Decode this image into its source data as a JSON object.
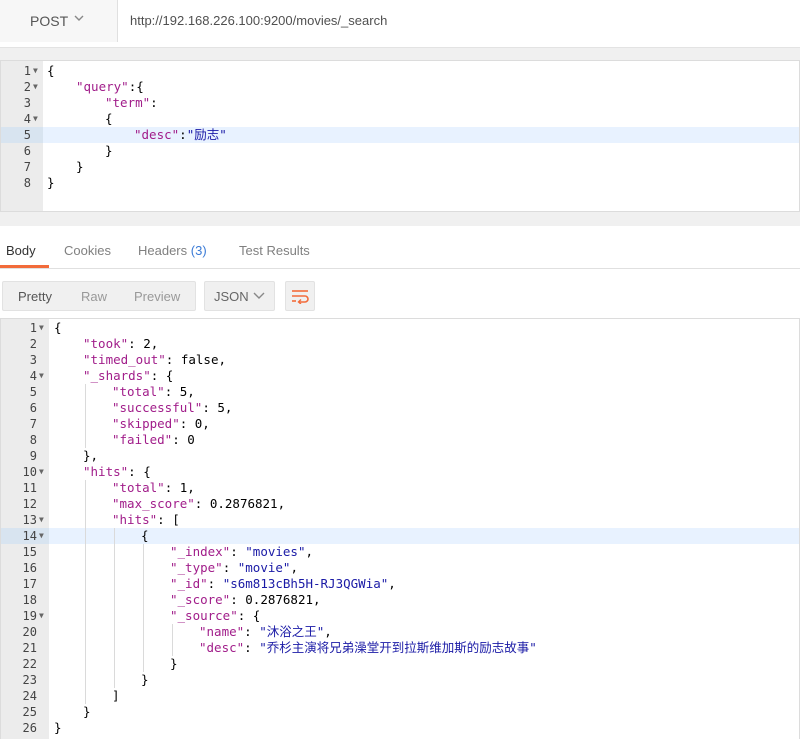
{
  "request": {
    "method": "POST",
    "url": "http://192.168.226.100:9200/movies/_search",
    "body_lines": [
      {
        "n": "1",
        "fold": true,
        "indent": 0,
        "tokens": [
          [
            "p",
            "{"
          ]
        ]
      },
      {
        "n": "2",
        "fold": true,
        "indent": 1,
        "tokens": [
          [
            "k",
            "\"query\""
          ],
          [
            "p",
            ":{"
          ]
        ]
      },
      {
        "n": "3",
        "fold": false,
        "indent": 2,
        "tokens": [
          [
            "k",
            "\"term\""
          ],
          [
            "p",
            ":"
          ]
        ]
      },
      {
        "n": "4",
        "fold": true,
        "indent": 2,
        "tokens": [
          [
            "p",
            "{"
          ]
        ]
      },
      {
        "n": "5",
        "fold": false,
        "indent": 3,
        "active": true,
        "tokens": [
          [
            "k",
            "\"desc\""
          ],
          [
            "p",
            ":"
          ],
          [
            "s",
            "\"励志\""
          ]
        ]
      },
      {
        "n": "6",
        "fold": false,
        "indent": 2,
        "tokens": [
          [
            "p",
            "}"
          ]
        ]
      },
      {
        "n": "7",
        "fold": false,
        "indent": 1,
        "tokens": [
          [
            "p",
            "}"
          ]
        ]
      },
      {
        "n": "8",
        "fold": false,
        "indent": 0,
        "tokens": [
          [
            "p",
            "}"
          ]
        ]
      }
    ]
  },
  "response_tabs": [
    {
      "label": "Body",
      "active": true
    },
    {
      "label": "Cookies"
    },
    {
      "label": "Headers",
      "badge": "(3)"
    },
    {
      "label": "Test Results"
    }
  ],
  "format_options": [
    "Pretty",
    "Raw",
    "Preview"
  ],
  "selected_format": "Pretty",
  "language": "JSON",
  "response_lines": [
    {
      "n": "1",
      "fold": true,
      "indent": 0,
      "tokens": [
        [
          "p",
          "{"
        ]
      ]
    },
    {
      "n": "2",
      "fold": false,
      "indent": 1,
      "tokens": [
        [
          "k",
          "\"took\""
        ],
        [
          "p",
          ": 2,"
        ]
      ]
    },
    {
      "n": "3",
      "fold": false,
      "indent": 1,
      "tokens": [
        [
          "k",
          "\"timed_out\""
        ],
        [
          "p",
          ": false,"
        ]
      ]
    },
    {
      "n": "4",
      "fold": true,
      "indent": 1,
      "tokens": [
        [
          "k",
          "\"_shards\""
        ],
        [
          "p",
          ": {"
        ]
      ]
    },
    {
      "n": "5",
      "fold": false,
      "indent": 2,
      "tokens": [
        [
          "k",
          "\"total\""
        ],
        [
          "p",
          ": 5,"
        ]
      ]
    },
    {
      "n": "6",
      "fold": false,
      "indent": 2,
      "tokens": [
        [
          "k",
          "\"successful\""
        ],
        [
          "p",
          ": 5,"
        ]
      ]
    },
    {
      "n": "7",
      "fold": false,
      "indent": 2,
      "tokens": [
        [
          "k",
          "\"skipped\""
        ],
        [
          "p",
          ": 0,"
        ]
      ]
    },
    {
      "n": "8",
      "fold": false,
      "indent": 2,
      "tokens": [
        [
          "k",
          "\"failed\""
        ],
        [
          "p",
          ": 0"
        ]
      ]
    },
    {
      "n": "9",
      "fold": false,
      "indent": 1,
      "tokens": [
        [
          "p",
          "},"
        ]
      ]
    },
    {
      "n": "10",
      "fold": true,
      "indent": 1,
      "tokens": [
        [
          "k",
          "\"hits\""
        ],
        [
          "p",
          ": {"
        ]
      ]
    },
    {
      "n": "11",
      "fold": false,
      "indent": 2,
      "tokens": [
        [
          "k",
          "\"total\""
        ],
        [
          "p",
          ": 1,"
        ]
      ]
    },
    {
      "n": "12",
      "fold": false,
      "indent": 2,
      "tokens": [
        [
          "k",
          "\"max_score\""
        ],
        [
          "p",
          ": 0.2876821,"
        ]
      ]
    },
    {
      "n": "13",
      "fold": true,
      "indent": 2,
      "tokens": [
        [
          "k",
          "\"hits\""
        ],
        [
          "p",
          ": ["
        ]
      ]
    },
    {
      "n": "14",
      "fold": true,
      "indent": 3,
      "active": true,
      "tokens": [
        [
          "p",
          "{"
        ]
      ]
    },
    {
      "n": "15",
      "fold": false,
      "indent": 4,
      "tokens": [
        [
          "k",
          "\"_index\""
        ],
        [
          "p",
          ": "
        ],
        [
          "s",
          "\"movies\""
        ],
        [
          "p",
          ","
        ]
      ]
    },
    {
      "n": "16",
      "fold": false,
      "indent": 4,
      "tokens": [
        [
          "k",
          "\"_type\""
        ],
        [
          "p",
          ": "
        ],
        [
          "s",
          "\"movie\""
        ],
        [
          "p",
          ","
        ]
      ]
    },
    {
      "n": "17",
      "fold": false,
      "indent": 4,
      "tokens": [
        [
          "k",
          "\"_id\""
        ],
        [
          "p",
          ": "
        ],
        [
          "s",
          "\"s6m813cBh5H-RJ3QGWia\""
        ],
        [
          "p",
          ","
        ]
      ]
    },
    {
      "n": "18",
      "fold": false,
      "indent": 4,
      "tokens": [
        [
          "k",
          "\"_score\""
        ],
        [
          "p",
          ": 0.2876821,"
        ]
      ]
    },
    {
      "n": "19",
      "fold": true,
      "indent": 4,
      "tokens": [
        [
          "k",
          "\"_source\""
        ],
        [
          "p",
          ": {"
        ]
      ]
    },
    {
      "n": "20",
      "fold": false,
      "indent": 5,
      "tokens": [
        [
          "k",
          "\"name\""
        ],
        [
          "p",
          ": "
        ],
        [
          "s",
          "\"沐浴之王\""
        ],
        [
          "p",
          ","
        ]
      ]
    },
    {
      "n": "21",
      "fold": false,
      "indent": 5,
      "tokens": [
        [
          "k",
          "\"desc\""
        ],
        [
          "p",
          ": "
        ],
        [
          "s",
          "\"乔杉主演将兄弟澡堂开到拉斯维加斯的励志故事\""
        ]
      ]
    },
    {
      "n": "22",
      "fold": false,
      "indent": 4,
      "tokens": [
        [
          "p",
          "}"
        ]
      ]
    },
    {
      "n": "23",
      "fold": false,
      "indent": 3,
      "tokens": [
        [
          "p",
          "}"
        ]
      ]
    },
    {
      "n": "24",
      "fold": false,
      "indent": 2,
      "tokens": [
        [
          "p",
          "]"
        ]
      ]
    },
    {
      "n": "25",
      "fold": false,
      "indent": 1,
      "tokens": [
        [
          "p",
          "}"
        ]
      ]
    },
    {
      "n": "26",
      "fold": false,
      "indent": 0,
      "tokens": [
        [
          "p",
          "}"
        ]
      ]
    }
  ],
  "colors": {
    "key": "#a11d8a",
    "string": "#1a1aa6",
    "accent_tab": "#f26b3a",
    "badge": "#3b7bd6",
    "active_line": "#e8f2ff"
  }
}
